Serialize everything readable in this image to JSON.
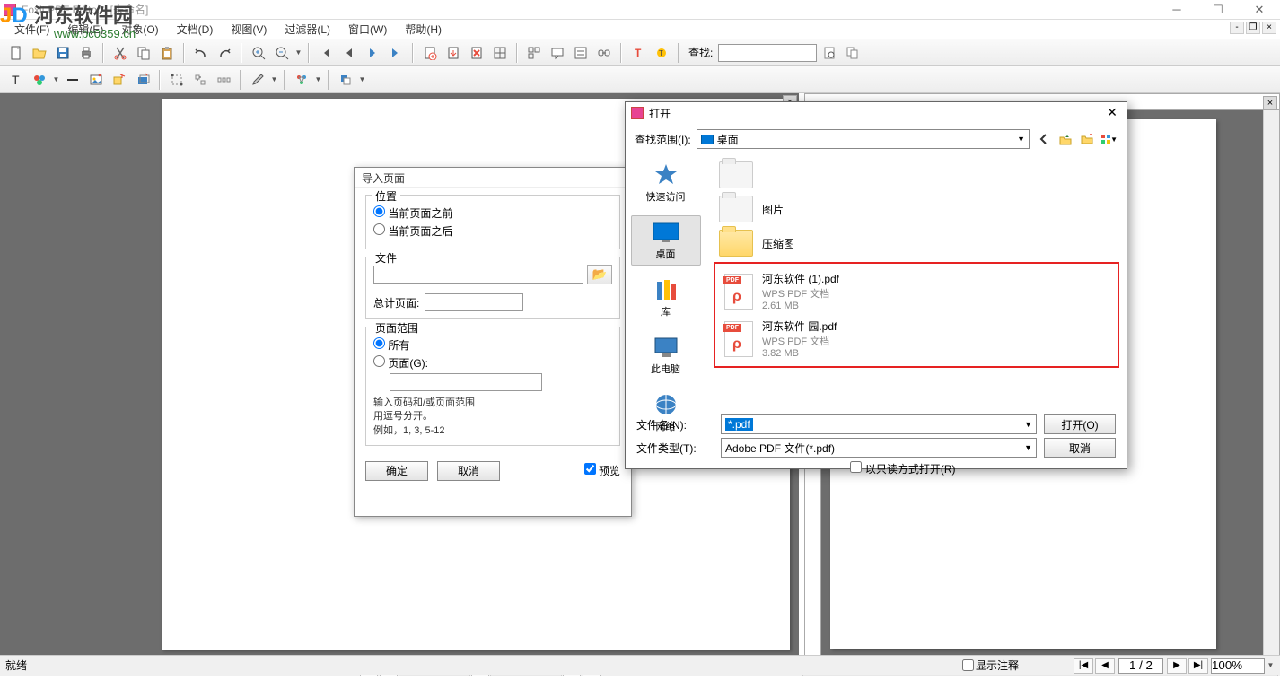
{
  "app": {
    "title": "Foxit PDF Editor - [未命名]"
  },
  "watermark": {
    "brand": "河东软件园",
    "url": "www.pc0359.cn"
  },
  "menu": {
    "file": "文件(F)",
    "edit": "编辑(E)",
    "object": "对象(O)",
    "document": "文档(D)",
    "view": "视图(V)",
    "filter": "过滤器(L)",
    "window": "窗口(W)",
    "help": "帮助(H)"
  },
  "toolbar": {
    "find_label": "查找:"
  },
  "import_dialog": {
    "title": "导入页面",
    "grp_pos": "位置",
    "opt_before": "当前页面之前",
    "opt_after": "当前页面之后",
    "grp_file": "文件",
    "open_icon": "📂",
    "total_label": "总计页面:",
    "grp_range": "页面范围",
    "opt_all": "所有",
    "opt_pages": "页面(G):",
    "hint1": "输入页码和/或页面范围",
    "hint2": "用逗号分开。",
    "hint3": "例如，1, 3, 5-12",
    "btn_ok": "确定",
    "btn_cancel": "取消",
    "cb_preview": "预览"
  },
  "open_dialog": {
    "title": "打开",
    "loc_label": "查找范围(I):",
    "loc_value": "桌面",
    "places": {
      "quick": "快速访问",
      "desktop": "桌面",
      "lib": "库",
      "thispc": "此电脑",
      "network": "网络"
    },
    "files": {
      "f0": "",
      "f1": "图片",
      "f2": "压缩图",
      "pdf1_name": "河东软件 (1).pdf",
      "pdf1_type": "WPS PDF 文档",
      "pdf1_size": "2.61 MB",
      "pdf2_name": "河东软件 园.pdf",
      "pdf2_type": "WPS PDF 文档",
      "pdf2_size": "3.82 MB"
    },
    "fn_label": "文件名(N):",
    "fn_value": "*.pdf",
    "ft_label": "文件类型(T):",
    "ft_value": "Adobe PDF 文件(*.pdf)",
    "cb_readonly": "以只读方式打开(R)",
    "btn_open": "打开(O)",
    "btn_cancel": "取消"
  },
  "status": {
    "ready": "就绪",
    "cb_annot": "显示注释",
    "page": "1 / 2",
    "zoom": "100%"
  }
}
